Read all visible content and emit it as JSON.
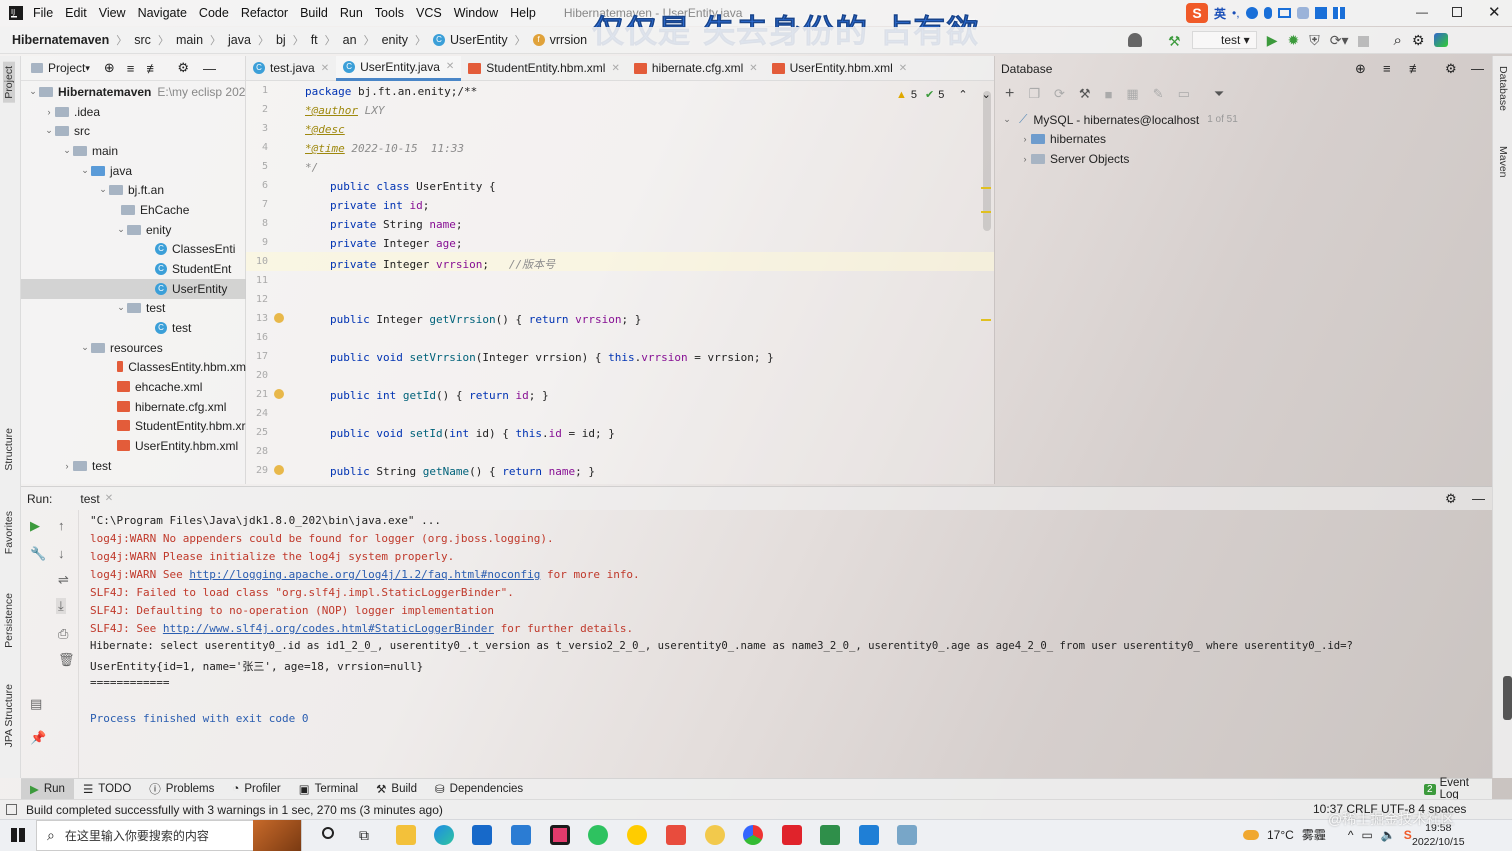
{
  "window": {
    "title": "Hibernatemaven - UserEntity.java",
    "watermark": "仅仅是 失去身份的 占有欲"
  },
  "menu": [
    "File",
    "Edit",
    "View",
    "Navigate",
    "Code",
    "Refactor",
    "Build",
    "Run",
    "Tools",
    "VCS",
    "Window",
    "Help"
  ],
  "breadcrumb": [
    "Hibernatemaven",
    "src",
    "main",
    "java",
    "bj",
    "ft",
    "an",
    "enity",
    "UserEntity",
    "vrrsion"
  ],
  "toolbar": {
    "run_config": "test"
  },
  "project_panel": {
    "title": "Project",
    "root": "Hibernatemaven",
    "root_path": "E:\\my eclisp 202",
    "items": {
      "idea": ".idea",
      "src": "src",
      "main": "main",
      "java": "java",
      "pkg": "bj.ft.an",
      "ehcache": "EhCache",
      "enity": "enity",
      "c1": "ClassesEnti",
      "c2": "StudentEnt",
      "c3": "UserEntity",
      "test1": "test",
      "testc": "test",
      "resources": "resources",
      "r1": "ClassesEntity.hbm.xm",
      "r2": "ehcache.xml",
      "r3": "hibernate.cfg.xml",
      "r4": "StudentEntity.hbm.xr",
      "r5": "UserEntity.hbm.xml",
      "test2": "test"
    }
  },
  "tabs": [
    "test.java",
    "UserEntity.java",
    "StudentEntity.hbm.xml",
    "hibernate.cfg.xml",
    "UserEntity.hbm.xml"
  ],
  "editor": {
    "warnings": "5",
    "checks": "5",
    "line_numbers": [
      "1",
      "2",
      "3",
      "4",
      "5",
      "6",
      "7",
      "8",
      "9",
      "10",
      "11",
      "12",
      "13",
      "16",
      "17",
      "20",
      "21",
      "24",
      "25",
      "28",
      "29"
    ],
    "line1": "bj.ft.an.enity;/**",
    "author_tag": "*@author",
    "author": " LXY",
    "desc_tag": "*@desc",
    "time_tag": "*@time",
    "time": " 2022-10-15  11:33",
    "close_cm": "*/",
    "comment_ver": "//版本号"
  },
  "database": {
    "title": "Database",
    "conn": "MySQL - hibernates@localhost",
    "count": "1 of 51",
    "schema": "hibernates",
    "server": "Server Objects"
  },
  "run": {
    "label": "Run:",
    "tab": "test",
    "lines": {
      "l1": "\"C:\\Program Files\\Java\\jdk1.8.0_202\\bin\\java.exe\" ...",
      "l2": "log4j:WARN No appenders could be found for logger (org.jboss.logging).",
      "l3": "log4j:WARN Please initialize the log4j system properly.",
      "l4a": "log4j:WARN See ",
      "l4b": "http://logging.apache.org/log4j/1.2/faq.html#noconfig",
      "l4c": " for more info.",
      "l5": "SLF4J: Failed to load class \"org.slf4j.impl.StaticLoggerBinder\".",
      "l6": "SLF4J: Defaulting to no-operation (NOP) logger implementation",
      "l7a": "SLF4J: See ",
      "l7b": "http://www.slf4j.org/codes.html#StaticLoggerBinder",
      "l7c": " for further details.",
      "l8": "Hibernate: select userentity0_.id as id1_2_0_, userentity0_.t_version as t_versio2_2_0_, userentity0_.name as name3_2_0_, userentity0_.age as age4_2_0_ from user userentity0_ where userentity0_.id=?",
      "l9": "UserEntity{id=1, name='张三', age=18, vrrsion=null}",
      "l10": "============",
      "l11": "Process finished with exit code 0"
    }
  },
  "bottom_tabs": [
    "Run",
    "TODO",
    "Problems",
    "Profiler",
    "Terminal",
    "Build",
    "Dependencies"
  ],
  "event_log": {
    "count": "2",
    "label": "Event Log"
  },
  "status": {
    "message": "Build completed successfully with 3 warnings in 1 sec, 270 ms (3 minutes ago)",
    "right": "10:37   CRLF   UTF-8   4 spaces"
  },
  "stripes": {
    "project": "Project",
    "structure": "Structure",
    "favorites": "Favorites",
    "persistence": "Persistence",
    "jpa": "JPA Structure",
    "database": "Database",
    "maven": "Maven"
  },
  "taskbar": {
    "search": "在这里输入你要搜索的内容",
    "temp": "17°C",
    "weather": "雾霾",
    "time": "19:58",
    "date": "2022/10/15",
    "ime": "英",
    "corner": "@稀土掘金技术社区"
  }
}
